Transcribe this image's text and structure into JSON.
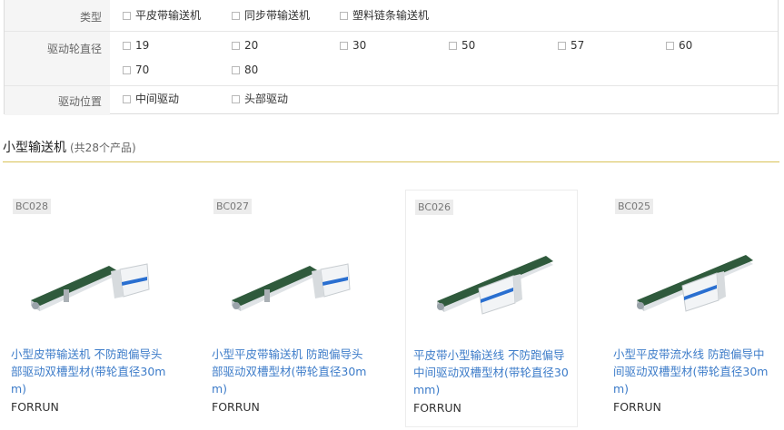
{
  "filters": [
    {
      "label": "类型",
      "options": [
        "平皮带输送机",
        "同步带输送机",
        "塑料链条输送机"
      ]
    },
    {
      "label": "驱动轮直径",
      "options": [
        "19",
        "20",
        "30",
        "50",
        "57",
        "60",
        "70",
        "80"
      ]
    },
    {
      "label": "驱动位置",
      "options": [
        "中间驱动",
        "头部驱动"
      ]
    }
  ],
  "section": {
    "title": "小型输送机",
    "count": "(共28个产品)"
  },
  "products": [
    {
      "sku": "BC028",
      "name": "小型皮带输送机 不防跑偏导头部驱动双槽型材(带轮直径30mm)",
      "brand": "FORRUN",
      "image": "conveyor-head-drive"
    },
    {
      "sku": "BC027",
      "name": "小型平皮带输送机 防跑偏导头部驱动双槽型材(带轮直径30mm)",
      "brand": "FORRUN",
      "image": "conveyor-head-drive"
    },
    {
      "sku": "BC026",
      "name": "平皮带小型输送线 不防跑偏导中间驱动双槽型材(带轮直径30mm)",
      "brand": "FORRUN",
      "image": "conveyor-center-drive"
    },
    {
      "sku": "BC025",
      "name": "小型平皮带流水线 防跑偏导中间驱动双槽型材(带轮直径30mm)",
      "brand": "FORRUN",
      "image": "conveyor-center-drive"
    }
  ],
  "colors": {
    "link": "#3d7cc9",
    "belt": "#2f5a3c",
    "accent": "#2a6fd0",
    "divider": "#d9c257"
  }
}
